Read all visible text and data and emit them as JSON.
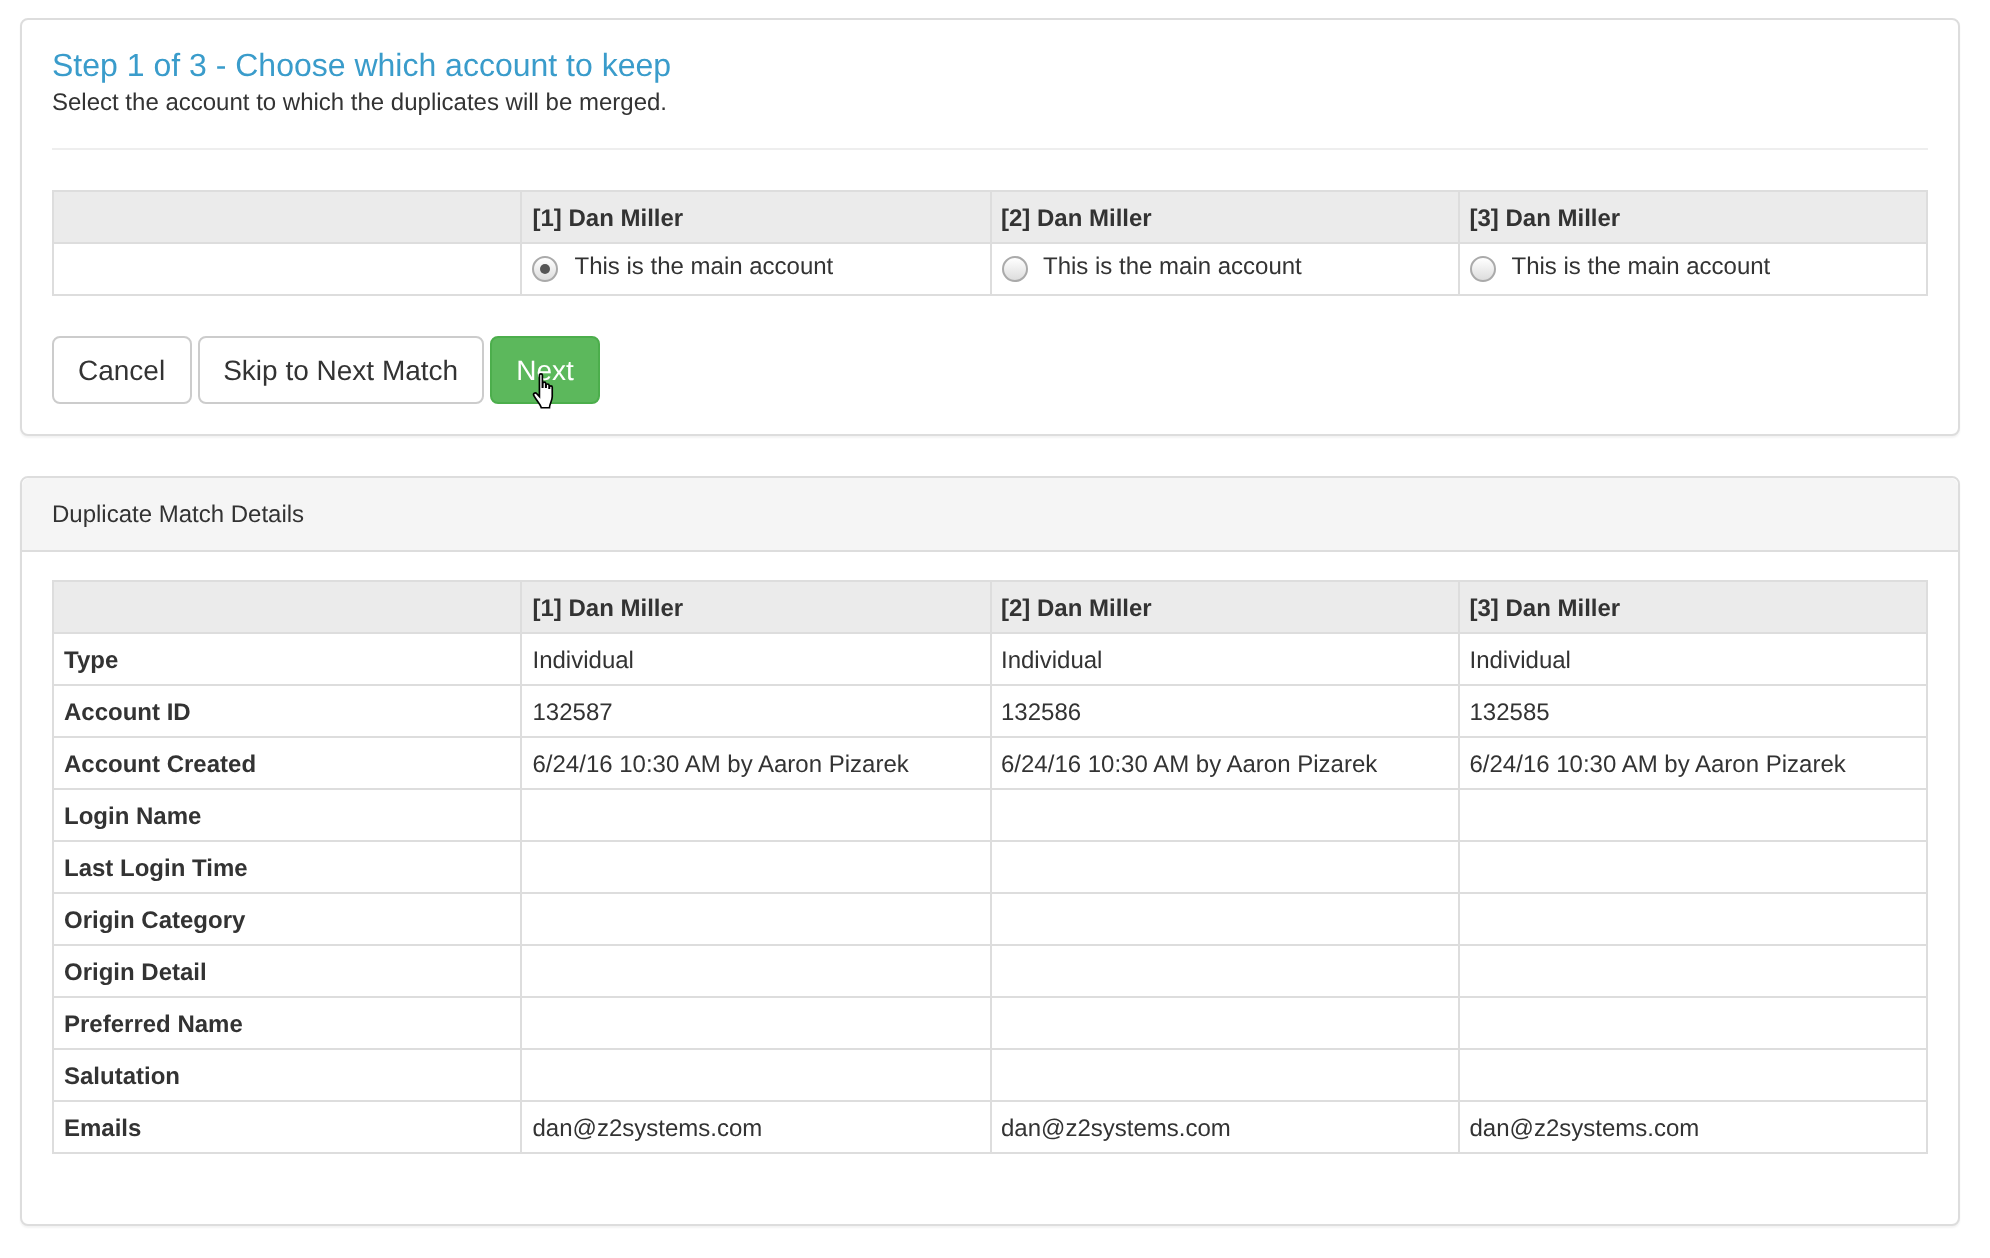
{
  "step_panel": {
    "title": "Step 1 of 3 - Choose which account to keep",
    "subtitle": "Select the account to which the duplicates will be merged.",
    "accounts": [
      {
        "name": "[1] Dan Miller",
        "option": "This is the main account",
        "selected": true
      },
      {
        "name": "[2] Dan Miller",
        "option": "This is the main account",
        "selected": false
      },
      {
        "name": "[3] Dan Miller",
        "option": "This is the main account",
        "selected": false
      }
    ],
    "buttons": [
      {
        "label": "Cancel",
        "kind": "default"
      },
      {
        "label": "Skip to Next Match",
        "kind": "default"
      },
      {
        "label": "Next",
        "kind": "primary"
      }
    ]
  },
  "details_panel": {
    "title": "Duplicate Match Details",
    "columns": [
      "[1] Dan Miller",
      "[2] Dan Miller",
      "[3] Dan Miller"
    ],
    "rows": [
      {
        "label": "Type",
        "values": [
          "Individual",
          "Individual",
          "Individual"
        ]
      },
      {
        "label": "Account ID",
        "values": [
          "132587",
          "132586",
          "132585"
        ]
      },
      {
        "label": "Account Created",
        "values": [
          "6/24/16 10:30 AM by Aaron Pizarek",
          "6/24/16 10:30 AM by Aaron Pizarek",
          "6/24/16 10:30 AM by Aaron Pizarek"
        ]
      },
      {
        "label": "Login Name"
      },
      {
        "label": "Last Login Time"
      },
      {
        "label": "Origin Category"
      },
      {
        "label": "Origin Detail"
      },
      {
        "label": "Preferred Name"
      },
      {
        "label": "Salutation"
      },
      {
        "label": "Emails",
        "values": [
          "dan@z2systems.com",
          "dan@z2systems.com",
          "dan@z2systems.com"
        ]
      }
    ]
  }
}
